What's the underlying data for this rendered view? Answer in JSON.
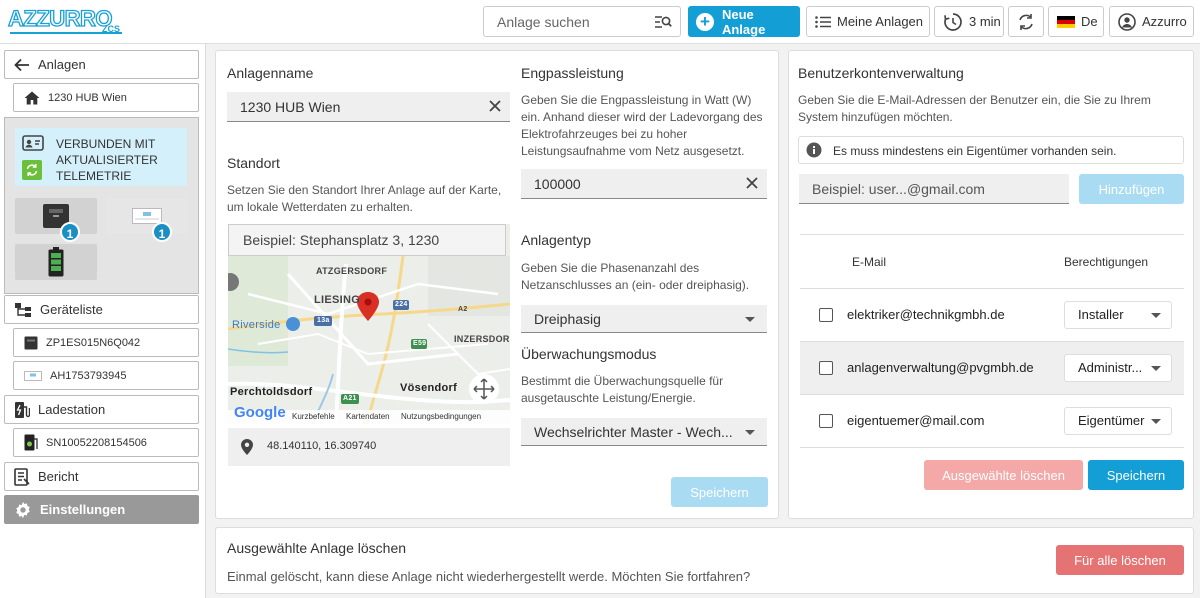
{
  "header": {
    "logo_text": "AZZURRO",
    "logo_sub": "ZCS",
    "search_placeholder": "Anlage suchen",
    "new_plant": "Neue Anlage",
    "my_plants": "Meine Anlagen",
    "refresh_interval": "3 min",
    "language": "De",
    "user": "Azzurro"
  },
  "sidebar": {
    "back_label": "Anlagen",
    "plant_name": "1230 HUB Wien",
    "status_text": "VERBUNDEN MIT AKTUALISIERTER TELEMETRIE",
    "device_badge_1": "1",
    "device_badge_2": "1",
    "device_list": "Geräteliste",
    "device_1": "ZP1ES015N6Q042",
    "device_2": "AH1753793945",
    "charging_station": "Ladestation",
    "charger_1": "SN10052208154506",
    "report": "Bericht",
    "settings": "Einstellungen"
  },
  "plant": {
    "name_label": "Anlagenname",
    "name_value": "1230 HUB Wien",
    "location_label": "Standort",
    "location_desc": "Setzen Sie den Standort Ihrer Anlage auf der Karte, um lokale Wetterdaten zu erhalten.",
    "map_search_placeholder": "Beispiel: Stephansplatz 3, 1230",
    "map_labels": [
      "ATZGERSDORF",
      "LIESING",
      "Riverside",
      "INZERSDORF",
      "Perchtoldsdorf",
      "Vösendorf",
      "224",
      "13a",
      "E59",
      "A21",
      "A2"
    ],
    "map_footer": [
      "Google",
      "Kurzbefehle",
      "Kartendaten",
      "Nutzungsbedingungen"
    ],
    "coordinates": "48.140110, 16.309740",
    "limit_label": "Engpassleistung",
    "limit_desc": "Geben Sie die Engpassleistung in Watt (W) ein. Anhand dieser wird der Ladevorgang des Elektrofahrzeuges bei zu hoher Leistungsaufnahme vom Netz ausgesetzt.",
    "limit_value": "100000",
    "type_label": "Anlagentyp",
    "type_desc": "Geben Sie die Phasenanzahl des Netzanschlusses an (ein- oder dreiphasig).",
    "type_value": "Dreiphasig",
    "monitor_label": "Überwachungsmodus",
    "monitor_desc": "Bestimmt die Überwachungsquelle für ausgetauschte Leistung/Energie.",
    "monitor_value": "Wechselrichter Master - Wech...",
    "save": "Speichern"
  },
  "accounts": {
    "title": "Benutzerkontenverwaltung",
    "desc": "Geben Sie die E-Mail-Adressen der Benutzer ein, die Sie zu Ihrem System hinzufügen möchten.",
    "info": "Es muss mindestens ein Eigentümer vorhanden sein.",
    "email_placeholder": "Beispiel: user...@gmail.com",
    "add": "Hinzufügen",
    "col_email": "E-Mail",
    "col_perm": "Berechtigungen",
    "rows": [
      {
        "email": "elektriker@technikgmbh.de",
        "perm": "Installer"
      },
      {
        "email": "anlagenverwaltung@pvgmbh.de",
        "perm": "Administr..."
      },
      {
        "email": "eigentuemer@mail.com",
        "perm": "Eigentümer"
      }
    ],
    "delete_selected": "Ausgewählte löschen",
    "save": "Speichern"
  },
  "delete_plant": {
    "title": "Ausgewählte Anlage löschen",
    "desc": "Einmal gelöscht, kann diese Anlage nicht wiederhergestellt werde. Möchten Sie fortfahren?",
    "button": "Für alle löschen"
  },
  "colors": {
    "accent": "#139ed6",
    "accent_light": "#a9dcf2",
    "danger": "#e57373",
    "danger_light": "#f4a8a8"
  }
}
